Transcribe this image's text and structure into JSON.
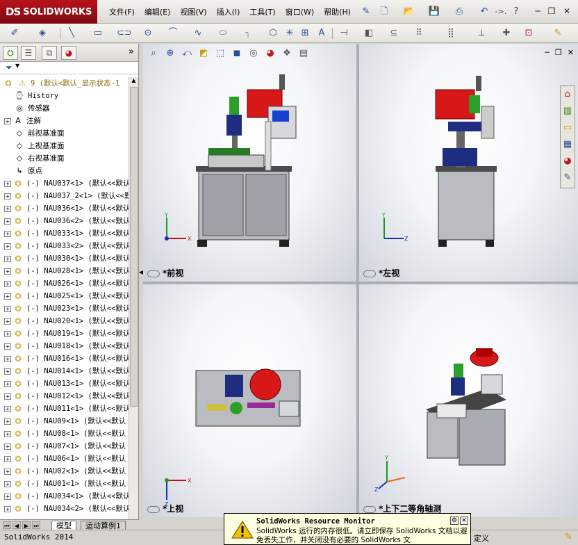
{
  "app": {
    "brand": "SOLIDWORKS",
    "brand_mark": "DS"
  },
  "menu": [
    "文件(F)",
    "编辑(E)",
    "视图(V)",
    "插入(I)",
    "工具(T)",
    "窗口(W)",
    "帮助(H)"
  ],
  "titlebar_extra": "->.",
  "feature_tree": {
    "root_label": "9  (默认<默认_显示状态-1",
    "fixed_items": [
      {
        "icon": "history-icon",
        "label": "History"
      },
      {
        "icon": "sensor-icon",
        "label": "传感器"
      },
      {
        "icon": "annotation-icon",
        "label": "注解"
      },
      {
        "icon": "plane-icon",
        "label": "前视基准面"
      },
      {
        "icon": "plane-icon",
        "label": "上视基准面"
      },
      {
        "icon": "plane-icon",
        "label": "右视基准面"
      },
      {
        "icon": "origin-icon",
        "label": "原点"
      }
    ],
    "components": [
      "(-) NAU037<1> (默认<<默认",
      "(-) NAU037_2<1> (默认<<默",
      "(-) NAU036<1> (默认<<默认",
      "(-) NAU036<2> (默认<<默认",
      "(-) NAU033<1> (默认<<默认",
      "(-) NAU033<2> (默认<<默认",
      "(-) NAU030<1> (默认<<默认",
      "(-) NAU028<1> (默认<<默认",
      "(-) NAU026<1> (默认<<默认",
      "(-) NAU025<1> (默认<<默认",
      "(-) NAU023<1> (默认<<默认",
      "(-) NAU020<1> (默认<<默认",
      "(-) NAU019<1> (默认<<默认",
      "(-) NAU018<1> (默认<<默认",
      "(-) NAU016<1> (默认<<默认",
      "(-) NAU014<1> (默认<<默认",
      "(-) NAU013<1> (默认<<默认",
      "(-) NAU012<1> (默认<<默认",
      "(-) NAU011<1> (默认<<默认",
      "(-) NAU09<1> (默认<<默认",
      "(-) NAU08<1> (默认<<默认",
      "(-) NAU07<1> (默认<<默认",
      "(-) NAU06<1> (默认<<默认",
      "(-) NAU02<1> (默认<<默认",
      "(-) NAU01<1> (默认<<默认",
      "(-) NAU034<1> (默认<<默认",
      "(-) NAU034<2> (默认<<默认"
    ]
  },
  "bottom_tabs": {
    "model": "模型",
    "motion": "运动算例1"
  },
  "viewports": {
    "front": "*前视",
    "left": "*左视",
    "top": "*上视",
    "iso": "*上下二等角轴测"
  },
  "axes": {
    "x": "X",
    "y": "Y",
    "z": "Z"
  },
  "status": {
    "left": "SolidWorks 2014",
    "right": "定义"
  },
  "popup": {
    "title": "SolidWorks Resource Monitor",
    "body": "SolidWorks 运行的内存很低。请立即保存 SolidWorks 文档以避免丢失工作，并关闭没有必要的 SolidWorks 文"
  },
  "colors": {
    "brand_red": "#b8121b",
    "accent_blue": "#2a4d9b",
    "warning_yellow": "#ffffe1"
  }
}
